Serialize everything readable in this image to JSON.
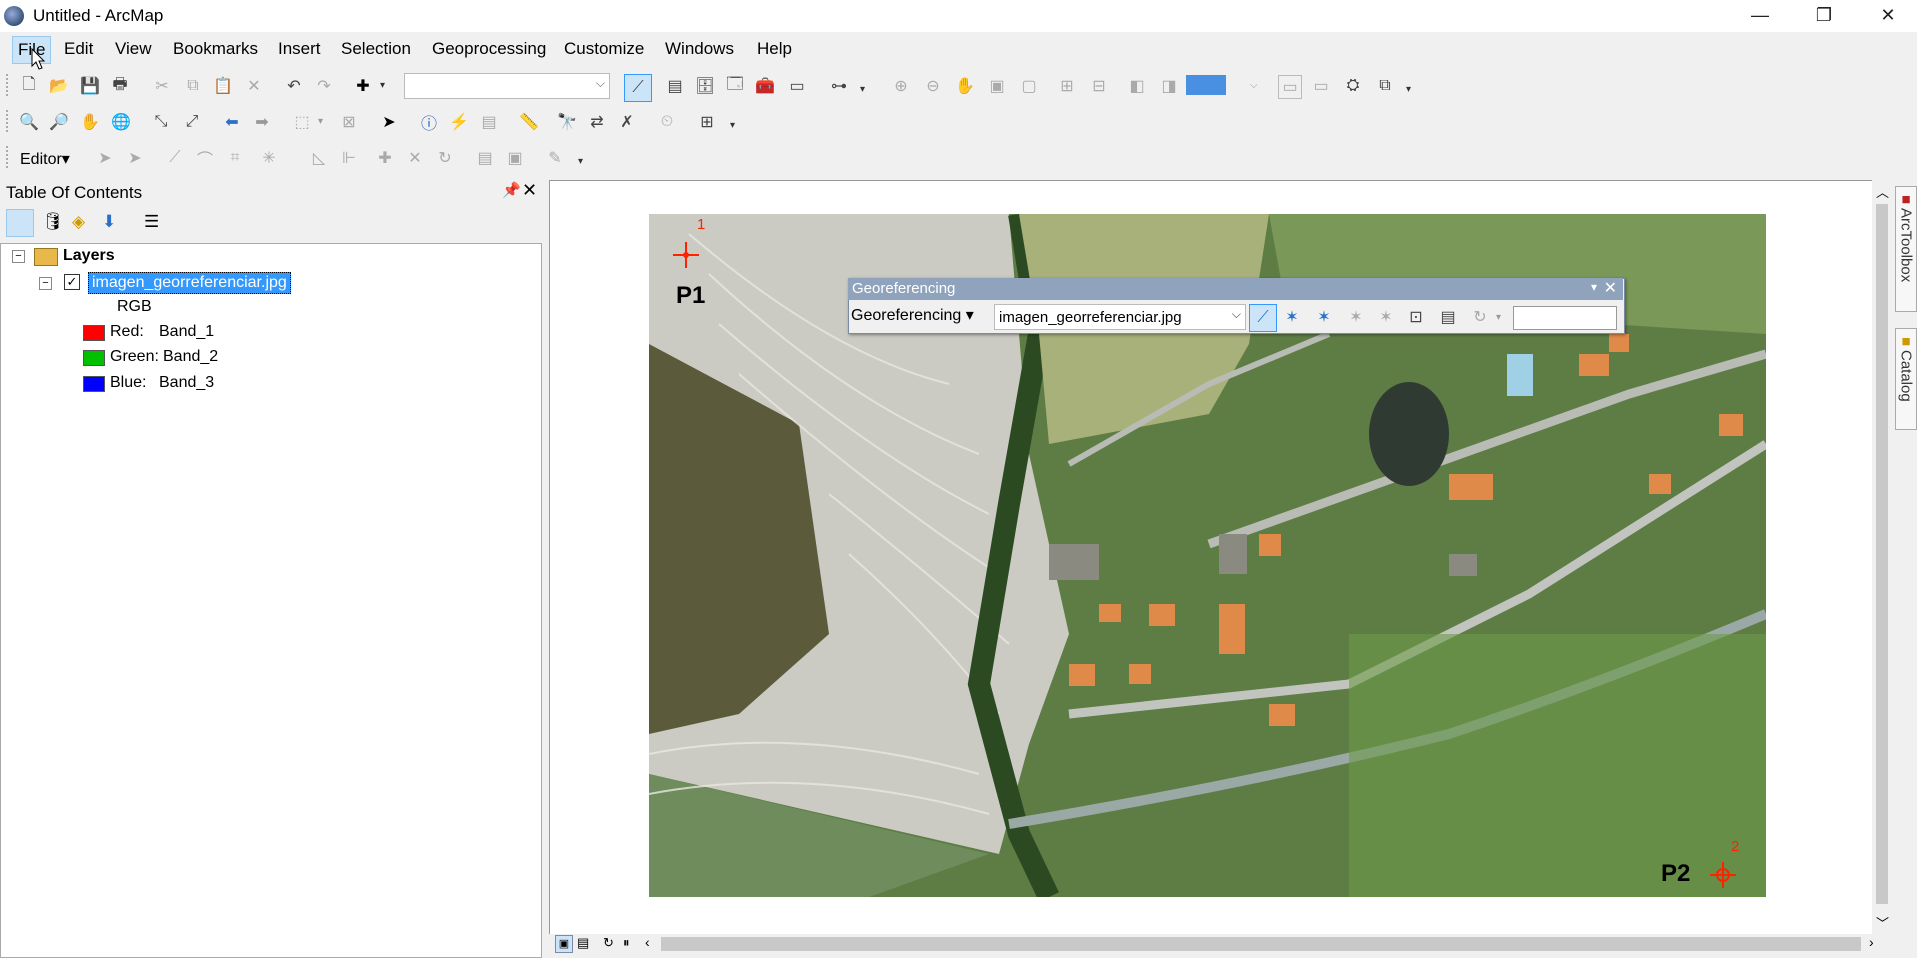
{
  "window": {
    "title": "Untitled - ArcMap",
    "minimize": "—",
    "restore": "❐",
    "close": "✕"
  },
  "menu": [
    "File",
    "Edit",
    "View",
    "Bookmarks",
    "Insert",
    "Selection",
    "Geoprocessing",
    "Customize",
    "Windows",
    "Help"
  ],
  "toolbar": {
    "scale_value": "",
    "editor_label": "Editor▾"
  },
  "toc": {
    "title": "Table Of Contents",
    "root_label": "Layers",
    "layer_name": "imagen_georreferenciar.jpg",
    "layer_checked": true,
    "render_label": "RGB",
    "bands": [
      {
        "label": "Red:",
        "band": "Band_1",
        "color": "#ff0000"
      },
      {
        "label": "Green:",
        "band": "Band_2",
        "color": "#00c000"
      },
      {
        "label": "Blue:",
        "band": "Band_3",
        "color": "#0000ff"
      }
    ]
  },
  "georef": {
    "title": "Georeferencing",
    "menu_label": "Georeferencing ▾",
    "layer_select": "imagen_georreferenciar.jpg",
    "input_value": ""
  },
  "map": {
    "p1_label": "P1",
    "p1_num": "1",
    "p2_label": "P2",
    "p2_num": "2"
  },
  "dock": {
    "arctoolbox": "ArcToolbox",
    "catalog": "Catalog"
  },
  "colors": {
    "selection": "#3399ff",
    "accent": "#cce4f7",
    "georef_title": "#8fa3bc",
    "control_point": "#ff2200"
  }
}
